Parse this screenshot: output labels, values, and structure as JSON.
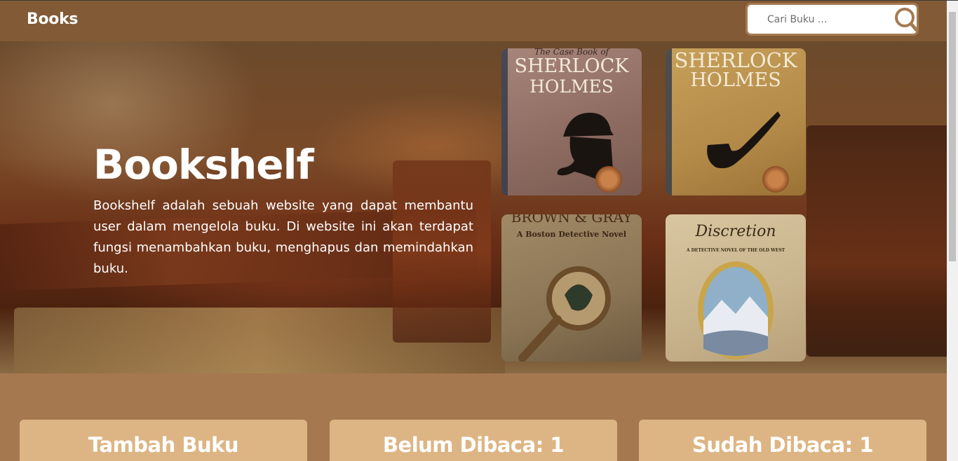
{
  "nav": {
    "brand": "Books",
    "search_placeholder": "Cari Buku ...",
    "search_icon": "search-icon"
  },
  "hero": {
    "title": "Bookshelf",
    "description": "Bookshelf adalah sebuah website yang dapat membantu user dalam mengelola buku. Di website ini akan terdapat fungsi menambahkan buku, menghapus dan memindahkan buku.",
    "covers": [
      {
        "line1": "The Case Book of",
        "line2": "SHERLOCK",
        "line3": "HOLMES"
      },
      {
        "line1": "",
        "line2": "SHERLOCK",
        "line3": "HOLMES"
      },
      {
        "line1": "BROWN & GRAY",
        "line2": "A Boston Detective Novel",
        "line3": ""
      },
      {
        "line1": "Discretion",
        "line2": "A DETECTIVE NOVEL OF THE OLD WEST",
        "line3": ""
      }
    ]
  },
  "cards": [
    {
      "title": "Tambah Buku"
    },
    {
      "title": "Belum Dibaca: 1"
    },
    {
      "title": "Sudah Dibaca: 1"
    }
  ],
  "colors": {
    "navbar": "#825a35",
    "page_bg": "#a5784f",
    "card_bg": "#ddb584",
    "search_border": "#a57a52"
  }
}
